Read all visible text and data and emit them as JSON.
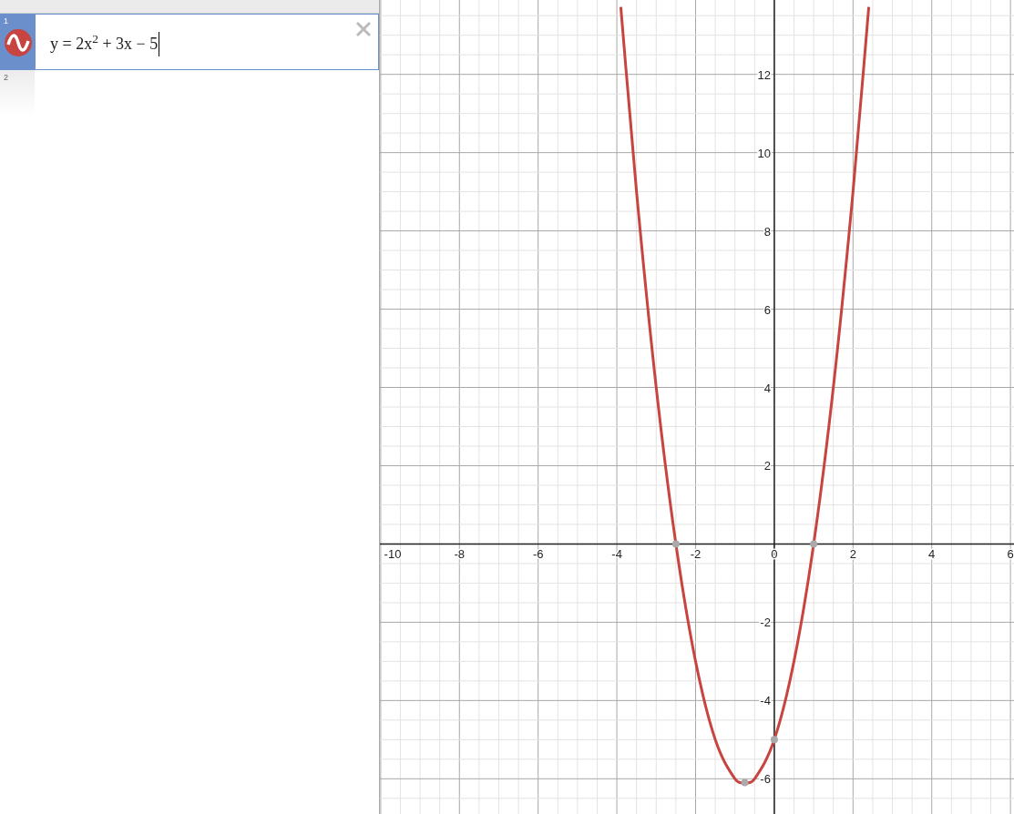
{
  "expressions": [
    {
      "number": "1",
      "selected": true,
      "latex": "y = 2x$^{2}$ + 3x − 5",
      "color": "#c74440"
    },
    {
      "number": "2",
      "selected": false
    }
  ],
  "graph": {
    "chart_data": {
      "type": "line",
      "x": [
        -3.9,
        -3.5,
        -3,
        -2.5,
        -2,
        -1.5,
        -1,
        -0.75,
        -0.5,
        0,
        0.5,
        1,
        1.5,
        2,
        2.4
      ],
      "series": [
        {
          "marker": "none",
          "color": "#c74440",
          "values": [
            13.72,
            9,
            4,
            0,
            -3,
            -5,
            -6,
            -6.1,
            -6,
            -5,
            -3,
            0,
            4,
            9,
            13.72
          ]
        },
        {
          "marker": "circle",
          "color": "#aaaaaa",
          "values": [
            null,
            null,
            null,
            0,
            null,
            null,
            null,
            -6.1,
            null,
            -5,
            null,
            0,
            null,
            null,
            null
          ]
        }
      ],
      "grid": true,
      "xlim": [
        -10.02,
        6.09
      ],
      "ylim": [
        -6.9,
        13.9
      ],
      "xticks": [
        {
          "value": -10,
          "label": "-10"
        },
        {
          "value": -8,
          "label": "-8"
        },
        {
          "value": -6,
          "label": "-6"
        },
        {
          "value": -4,
          "label": "-4"
        },
        {
          "value": -2,
          "label": "-2"
        },
        {
          "value": 0,
          "label": "0"
        },
        {
          "value": 2,
          "label": "2"
        },
        {
          "value": 4,
          "label": "4"
        },
        {
          "value": 6,
          "label": "6"
        }
      ],
      "yticks": [
        {
          "value": -6,
          "label": "-6"
        },
        {
          "value": -4,
          "label": "-4"
        },
        {
          "value": -2,
          "label": "-2"
        },
        {
          "value": 2,
          "label": "2"
        },
        {
          "value": 4,
          "label": "4"
        },
        {
          "value": 6,
          "label": "6"
        },
        {
          "value": 8,
          "label": "8"
        },
        {
          "value": 10,
          "label": "10"
        },
        {
          "value": 12,
          "label": "12"
        }
      ]
    }
  }
}
